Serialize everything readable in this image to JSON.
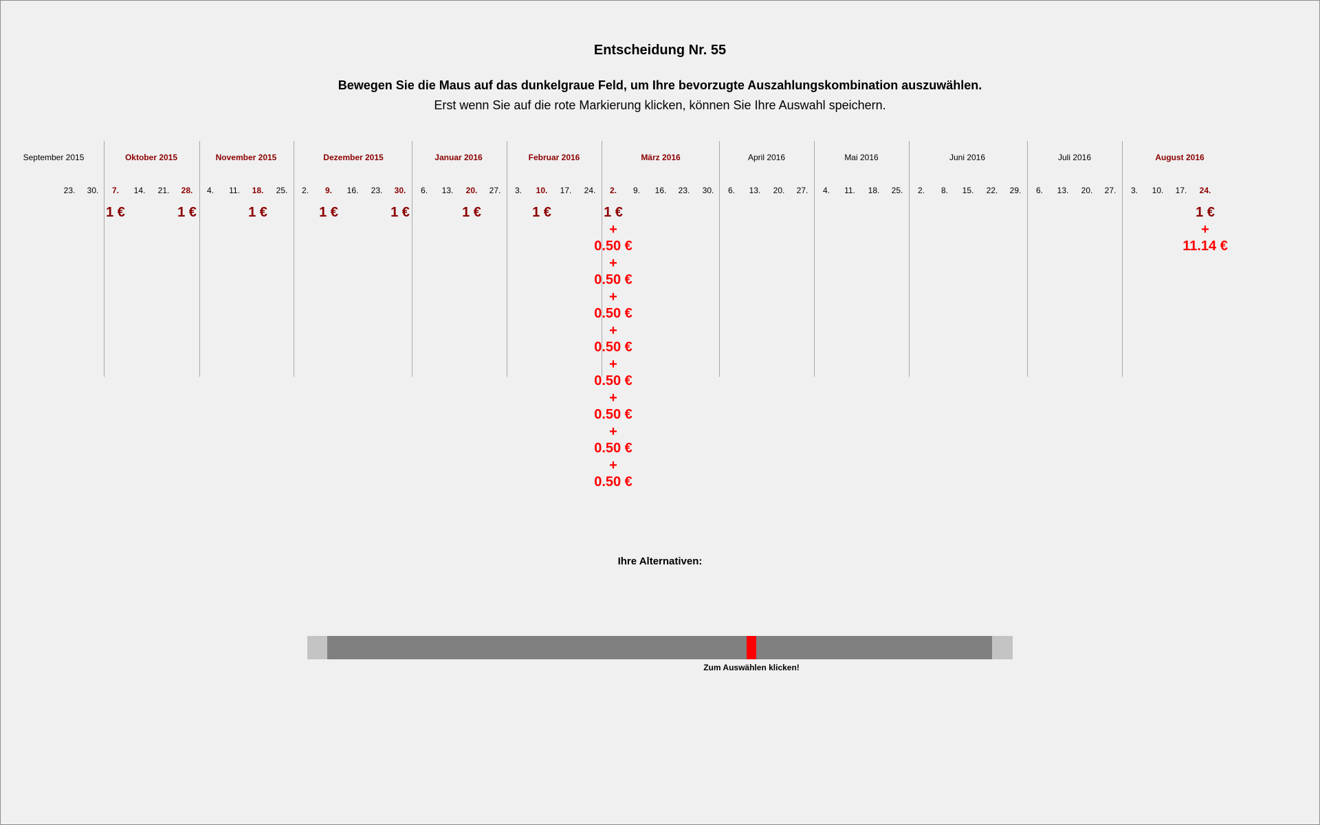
{
  "header": {
    "title": "Entscheidung Nr. 55",
    "instruction_bold": "Bewegen Sie die Maus auf das dunkelgraue Feld, um Ihre bevorzugte Auszahlungskombination auszuwählen.",
    "instruction_normal": "Erst wenn Sie auf die rote Markierung klicken, können Sie Ihre Auswahl speichern."
  },
  "months": [
    {
      "label": "September 2015",
      "marked": false
    },
    {
      "label": "Oktober 2015",
      "marked": true
    },
    {
      "label": "November 2015",
      "marked": true
    },
    {
      "label": "Dezember 2015",
      "marked": true
    },
    {
      "label": "Januar 2016",
      "marked": true
    },
    {
      "label": "Februar 2016",
      "marked": true
    },
    {
      "label": "März 2016",
      "marked": true
    },
    {
      "label": "April 2016",
      "marked": false
    },
    {
      "label": "Mai 2016",
      "marked": false
    },
    {
      "label": "Juni 2016",
      "marked": false
    },
    {
      "label": "Juli 2016",
      "marked": false
    },
    {
      "label": "August 2016",
      "marked": true
    }
  ],
  "days": [
    {
      "label": "23.",
      "marked": false
    },
    {
      "label": "30.",
      "marked": false
    },
    {
      "label": "7.",
      "marked": true
    },
    {
      "label": "14.",
      "marked": false
    },
    {
      "label": "21.",
      "marked": false
    },
    {
      "label": "28.",
      "marked": true
    },
    {
      "label": "4.",
      "marked": false
    },
    {
      "label": "11.",
      "marked": false
    },
    {
      "label": "18.",
      "marked": true
    },
    {
      "label": "25.",
      "marked": false
    },
    {
      "label": "2.",
      "marked": false
    },
    {
      "label": "9.",
      "marked": true
    },
    {
      "label": "16.",
      "marked": false
    },
    {
      "label": "23.",
      "marked": false
    },
    {
      "label": "30.",
      "marked": true
    },
    {
      "label": "6.",
      "marked": false
    },
    {
      "label": "13.",
      "marked": false
    },
    {
      "label": "20.",
      "marked": true
    },
    {
      "label": "27.",
      "marked": false
    },
    {
      "label": "3.",
      "marked": false
    },
    {
      "label": "10.",
      "marked": true
    },
    {
      "label": "17.",
      "marked": false
    },
    {
      "label": "24.",
      "marked": false
    },
    {
      "label": "2.",
      "marked": true
    },
    {
      "label": "9.",
      "marked": false
    },
    {
      "label": "16.",
      "marked": false
    },
    {
      "label": "23.",
      "marked": false
    },
    {
      "label": "30.",
      "marked": false
    },
    {
      "label": "6.",
      "marked": false
    },
    {
      "label": "13.",
      "marked": false
    },
    {
      "label": "20.",
      "marked": false
    },
    {
      "label": "27.",
      "marked": false
    },
    {
      "label": "4.",
      "marked": false
    },
    {
      "label": "11.",
      "marked": false
    },
    {
      "label": "18.",
      "marked": false
    },
    {
      "label": "25.",
      "marked": false
    },
    {
      "label": "2.",
      "marked": false
    },
    {
      "label": "8.",
      "marked": false
    },
    {
      "label": "15.",
      "marked": false
    },
    {
      "label": "22.",
      "marked": false
    },
    {
      "label": "29.",
      "marked": false
    },
    {
      "label": "6.",
      "marked": false
    },
    {
      "label": "13.",
      "marked": false
    },
    {
      "label": "20.",
      "marked": false
    },
    {
      "label": "27.",
      "marked": false
    },
    {
      "label": "3.",
      "marked": false
    },
    {
      "label": "10.",
      "marked": false
    },
    {
      "label": "17.",
      "marked": false
    },
    {
      "label": "24.",
      "marked": true
    }
  ],
  "payments": [
    {
      "day_index": 2,
      "lines": [
        "1 €"
      ],
      "style": "dark"
    },
    {
      "day_index": 5,
      "lines": [
        "1 €"
      ],
      "style": "dark"
    },
    {
      "day_index": 8,
      "lines": [
        "1 €"
      ],
      "style": "dark"
    },
    {
      "day_index": 11,
      "lines": [
        "1 €"
      ],
      "style": "dark"
    },
    {
      "day_index": 14,
      "lines": [
        "1 €"
      ],
      "style": "dark"
    },
    {
      "day_index": 17,
      "lines": [
        "1 €"
      ],
      "style": "dark"
    },
    {
      "day_index": 20,
      "lines": [
        "1 €"
      ],
      "style": "dark"
    },
    {
      "day_index": 23,
      "lines": [
        "1 €"
      ],
      "style": "dark"
    },
    {
      "day_index": 23,
      "lines": [
        "+",
        "0.50 €",
        "+",
        "0.50 €",
        "+",
        "0.50 €",
        "+",
        "0.50 €",
        "+",
        "0.50 €",
        "+",
        "0.50 €",
        "+",
        "0.50 €",
        "+",
        "0.50 €"
      ],
      "style": "bright"
    },
    {
      "day_index": 48,
      "lines": [
        "1 €"
      ],
      "style": "dark"
    },
    {
      "day_index": 48,
      "lines": [
        "+",
        "11.14 €"
      ],
      "style": "bright"
    }
  ],
  "alternatives": {
    "label": "Ihre Alternativen:",
    "click_hint": "Zum Auswählen klicken!",
    "marker_position": 0.64
  },
  "colors": {
    "marked_text": "#8b0000",
    "bright_red": "#ff0000",
    "track": "#808080",
    "track_edge": "#c3c3c3"
  }
}
